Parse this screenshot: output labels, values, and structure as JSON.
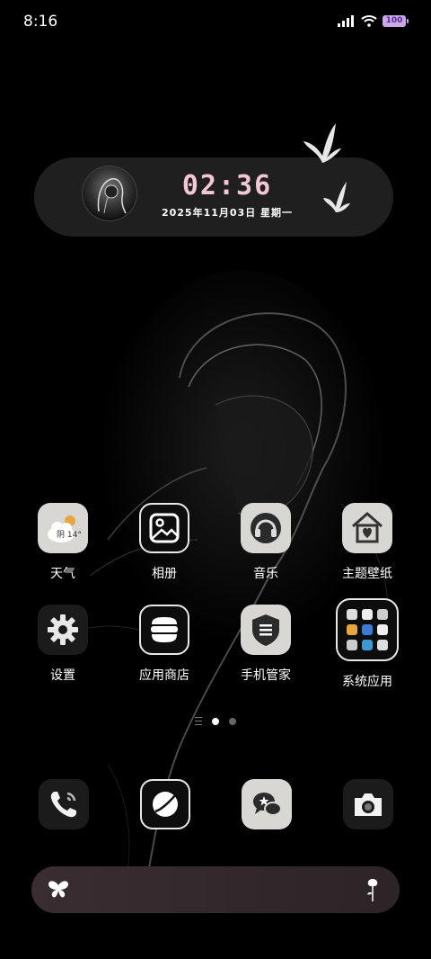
{
  "status_bar": {
    "time": "8:16",
    "battery": "100",
    "icons": [
      "signal-icon",
      "wifi-icon",
      "battery-icon"
    ]
  },
  "clock_widget": {
    "time": "02:36",
    "date": "2025年11月03日 星期一"
  },
  "apps": [
    {
      "label": "天气",
      "icon": "weather-icon",
      "temp": "阴 14°"
    },
    {
      "label": "相册",
      "icon": "gallery-icon"
    },
    {
      "label": "音乐",
      "icon": "music-icon"
    },
    {
      "label": "主题壁纸",
      "icon": "theme-icon"
    },
    {
      "label": "设置",
      "icon": "settings-icon"
    },
    {
      "label": "应用商店",
      "icon": "app-store-icon"
    },
    {
      "label": "手机管家",
      "icon": "phone-manager-icon"
    },
    {
      "label": "系统应用",
      "icon": "system-apps-folder-icon"
    }
  ],
  "page_indicator": {
    "pages": 2,
    "active": 0
  },
  "dock": [
    {
      "icon": "phone-icon"
    },
    {
      "icon": "browser-icon"
    },
    {
      "icon": "messages-icon"
    },
    {
      "icon": "camera-icon"
    }
  ],
  "colors": {
    "background": "#000000",
    "clock_text": "#f4c6d6",
    "widget_bg": "#1f1f1f",
    "battery": "#c9a8e8"
  }
}
